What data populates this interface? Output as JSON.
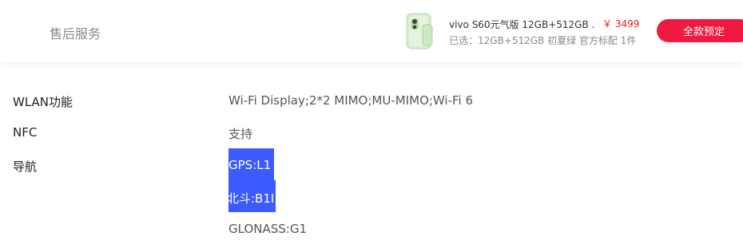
{
  "header": {
    "nav_label": "售后服务",
    "product": {
      "title": "vivo S60元气版 12GB+512GB ...",
      "price": "￥ 3499",
      "selected": "已选：12GB+512GB 初夏绿 官方标配 1件",
      "image_icon": "phone-thumbnail"
    },
    "buy_button": "全款预定"
  },
  "specs": [
    {
      "label": "WLAN功能",
      "value": "Wi-Fi Display;2*2 MIMO;MU-MIMO;Wi-Fi 6"
    },
    {
      "label": "NFC",
      "value": "支持"
    },
    {
      "label": "导航",
      "values": [
        "GPS:L1",
        "北斗:B1I",
        "GLONASS:G1"
      ]
    }
  ],
  "colors": {
    "accent": "#ee1a41",
    "price": "#e02020",
    "selection": "#3c5bff"
  }
}
